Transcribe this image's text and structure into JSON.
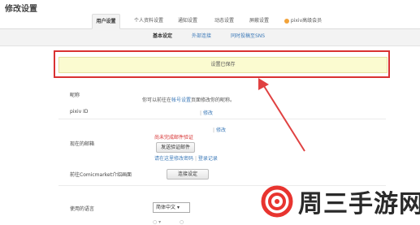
{
  "page": {
    "title": "修改设置"
  },
  "tabs": [
    {
      "label": "用户设置",
      "active": true
    },
    {
      "label": "个人资料设置",
      "active": false
    },
    {
      "label": "通知设置",
      "active": false
    },
    {
      "label": "动态设置",
      "active": false
    },
    {
      "label": "屏蔽设置",
      "active": false
    },
    {
      "label": "pixiv高级会员",
      "active": false
    }
  ],
  "subtabs": [
    {
      "label": "基本设定",
      "active": true
    },
    {
      "label": "外部连接",
      "active": false
    },
    {
      "label": "同时投稿至SNS",
      "active": false
    }
  ],
  "notice": {
    "text": "设置已保存"
  },
  "form": {
    "nickname": {
      "label": "昵称",
      "text_prefix": "你可以前往在",
      "link": "帐号设置",
      "text_suffix": "页面修改你的昵称。"
    },
    "pixiv_id": {
      "label": "pixiv ID",
      "edit": "修改"
    },
    "email": {
      "label": "现在的邮箱",
      "unverified": "尚未完成邮件验证",
      "edit": "修改",
      "send_button": "发送验证邮件",
      "change_password": "请在这里修改密码",
      "login_history": "登录记录"
    },
    "comicmarket": {
      "label": "前往Comicmarket介绍画面",
      "button": "连接设定"
    },
    "language": {
      "label": "使用的语言",
      "selected": "简体中文"
    }
  },
  "watermark": {
    "text": "周三手游网"
  },
  "colors": {
    "highlight": "#d93232",
    "link": "#3d7ab8",
    "notice_bg": "#fbfbd0"
  }
}
